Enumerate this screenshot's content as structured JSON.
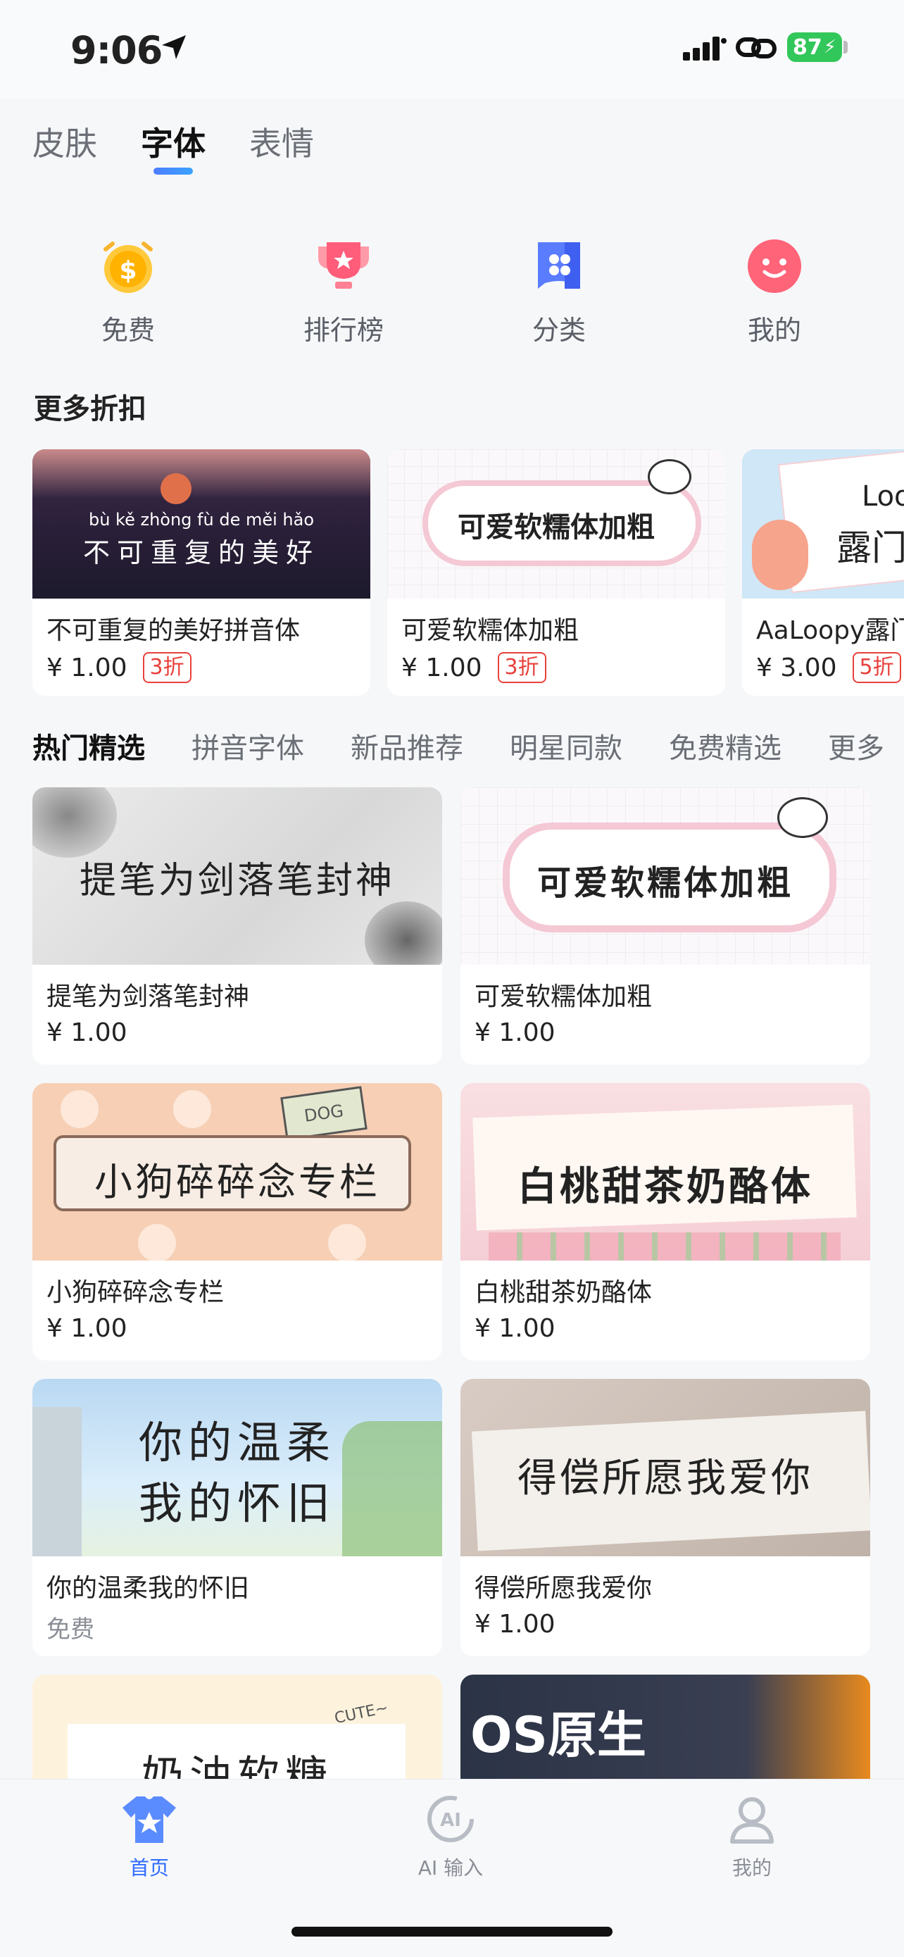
{
  "status_bar": {
    "time": "9:06",
    "battery": "87"
  },
  "top_tabs": [
    {
      "label": "皮肤",
      "active": false
    },
    {
      "label": "字体",
      "active": true
    },
    {
      "label": "表情",
      "active": false
    }
  ],
  "quick_nav": [
    {
      "label": "免费",
      "icon": "coin-icon"
    },
    {
      "label": "排行榜",
      "icon": "trophy-icon"
    },
    {
      "label": "分类",
      "icon": "category-icon"
    },
    {
      "label": "我的",
      "icon": "smile-face-icon"
    }
  ],
  "discount_section": {
    "title": "更多折扣",
    "items": [
      {
        "name": "不可重复的美好拼音体",
        "price": "¥ 1.00",
        "badge": "3折",
        "thumb_text": "不可重复的美好",
        "thumb_pinyin": "bù kě zhòng fù de měi hǎo"
      },
      {
        "name": "可爱软糯体加粗",
        "price": "¥ 1.00",
        "badge": "3折",
        "thumb_text": "可爱软糯体加粗"
      },
      {
        "name": "AaLoopy露门",
        "price": "¥ 3.00",
        "badge": "5折",
        "thumb_text": "露门",
        "thumb_text2": "Loo"
      }
    ]
  },
  "category_tabs": [
    {
      "label": "热门精选",
      "active": true
    },
    {
      "label": "拼音字体",
      "active": false
    },
    {
      "label": "新品推荐",
      "active": false
    },
    {
      "label": "明星同款",
      "active": false
    },
    {
      "label": "免费精选",
      "active": false
    },
    {
      "label": "更多",
      "active": false
    }
  ],
  "font_grid": [
    {
      "name": "提笔为剑落笔封神",
      "price": "¥ 1.00",
      "thumb_text": "提笔为剑落笔封神"
    },
    {
      "name": "可爱软糯体加粗",
      "price": "¥ 1.00",
      "thumb_text": "可爱软糯体加粗"
    },
    {
      "name": "小狗碎碎念专栏",
      "price": "¥ 1.00",
      "thumb_text": "小狗碎碎念专栏",
      "thumb_tag": "DOG"
    },
    {
      "name": "白桃甜茶奶酪体",
      "price": "¥ 1.00",
      "thumb_text": "白桃甜茶奶酪体"
    },
    {
      "name": "你的温柔我的怀旧",
      "price": "免费",
      "thumb_text": "你的温柔",
      "thumb_text2": "我的怀旧"
    },
    {
      "name": "得偿所愿我爱你",
      "price": "¥ 1.00",
      "thumb_text": "得偿所愿我爱你"
    },
    {
      "name": "",
      "price": "",
      "thumb_text": "奶油软糖",
      "thumb_tag": "CUTE~"
    },
    {
      "name": "",
      "price": "",
      "thumb_text": "OS原生"
    }
  ],
  "bottom_tabs": [
    {
      "label": "首页",
      "icon": "shirt-star-icon",
      "active": true
    },
    {
      "label": "AI 输入",
      "icon": "ai-input-icon",
      "active": false
    },
    {
      "label": "我的",
      "icon": "user-icon",
      "active": false
    }
  ]
}
